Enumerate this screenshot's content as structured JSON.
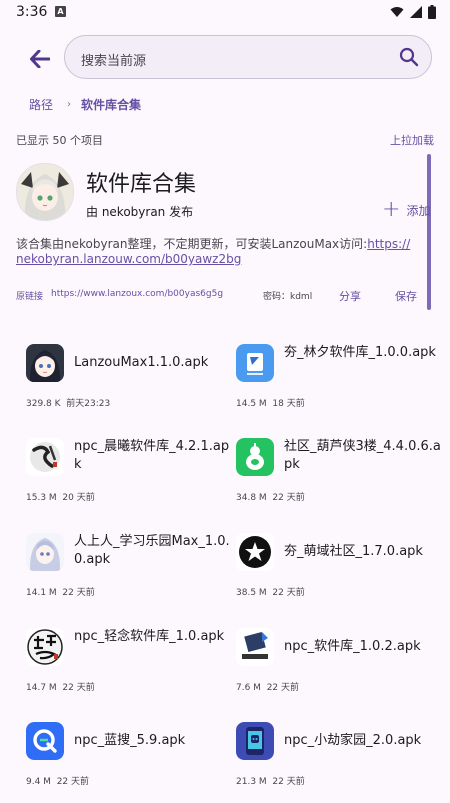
{
  "status": {
    "time": "3:36",
    "app_badge": "A"
  },
  "search": {
    "placeholder": "搜索当前源"
  },
  "breadcrumb": {
    "root": "路径",
    "separator": "›",
    "current": "软件库合集"
  },
  "list_header": {
    "count_text": "已显示 50 个项目",
    "pull_load": "上拉加载"
  },
  "collection": {
    "title": "软件库合集",
    "owner": "由 nekobyran 发布",
    "add_label": "添加",
    "description_prefix": "该合集由nekobyran整理，不定期更新，可安装LanzouMax访问:",
    "description_link_a": "https://",
    "description_link_b": "nekobyran.lanzouw.com/b00yawz2bg",
    "orig_label": "原链接",
    "orig_url": "https://www.lanzoux.com/b00yas6g5g",
    "password": "密码：kdml",
    "share": "分享",
    "save": "保存"
  },
  "files": [
    {
      "name": "LanzouMax1.1.0.apk",
      "size": "329.8 K",
      "time": "前天23:23",
      "icon": "anime-girl-icon"
    },
    {
      "name": "夯_林夕软件库_1.0.0.apk",
      "size": "14.5 M",
      "time": "18 天前",
      "icon": "blue-app-icon"
    },
    {
      "name": "npc_晨曦软件库_4.2.1.apk",
      "size": "15.3 M",
      "time": "20 天前",
      "icon": "ink-calligraphy-icon"
    },
    {
      "name": "社区_葫芦侠3楼_4.4.0.6.apk",
      "size": "34.8 M",
      "time": "22 天前",
      "icon": "gourd-icon"
    },
    {
      "name": "人上人_学习乐园Max_1.0.0.apk",
      "size": "14.1 M",
      "time": "22 天前",
      "icon": "anime-girl-icon"
    },
    {
      "name": "夯_萌域社区_1.7.0.apk",
      "size": "38.5 M",
      "time": "22 天前",
      "icon": "star-icon"
    },
    {
      "name": "npc_轻念软件库_1.0.apk",
      "size": "14.7 M",
      "time": "22 天前",
      "icon": "calligraphy-icon"
    },
    {
      "name": "npc_软件库_1.0.2.apk",
      "size": "7.6 M",
      "time": "22 天前",
      "icon": "cube-logo-icon"
    },
    {
      "name": "npc_蓝搜_5.9.apk",
      "size": "9.4 M",
      "time": "22 天前",
      "icon": "search-q-icon"
    },
    {
      "name": "npc_小劫家园_2.0.apk",
      "size": "21.3 M",
      "time": "22 天前",
      "icon": "phone-robot-icon"
    }
  ]
}
